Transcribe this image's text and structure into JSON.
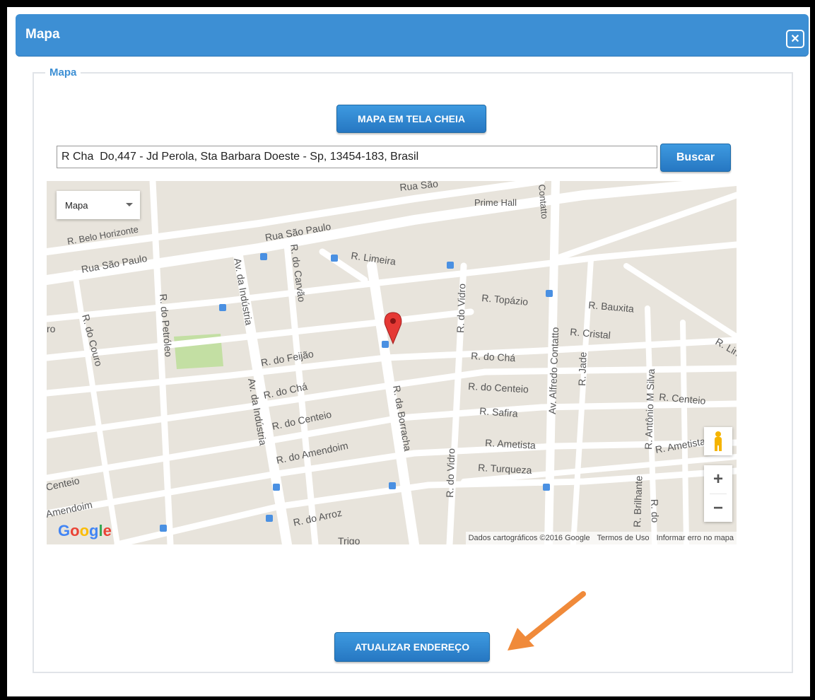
{
  "dialog": {
    "title": "Mapa",
    "close_icon": "close-icon"
  },
  "fieldset": {
    "legend": "Mapa"
  },
  "buttons": {
    "fullscreen": "MAPA EM TELA CHEIA",
    "search": "Buscar",
    "update": "ATUALIZAR ENDEREÇO"
  },
  "search": {
    "value": "R Cha  Do,447 - Jd Perola, Sta Barbara Doeste - Sp, 13454-183, Brasil"
  },
  "map": {
    "type_select": "Mapa",
    "streets": [
      "Rua São Paulo",
      "Rua São Paulo",
      "R. Belo Horizonte",
      "R. Limeira",
      "Prime Hall",
      "Contatto",
      "R. Topázio",
      "R. Bauxita",
      "R. Cristal",
      "R. do Chá",
      "R. do Centeio",
      "R. Centeio",
      "R. Safira",
      "R. Ametista",
      "R. Ametista",
      "R. Turqueza",
      "R. do Feijão",
      "R. do Chá",
      "R. do Centeio",
      "R. do Amendoim",
      "R. do Arroz",
      "R. do Petróleo",
      "R. do Couro",
      "Av. da Indústria",
      "Av. da Indústria",
      "R. do Carvão",
      "R. da Borracha",
      "R. do Vidro",
      "R. do Vidro",
      "Av. Alfredo Contatto",
      "R. Jade",
      "R. Antônio M Silva",
      "R. Brilhante",
      "Rua São",
      "R. Lin",
      "Centeio",
      "Amendoim",
      "ro",
      "Trigo",
      "R. do"
    ],
    "attribution": {
      "data": "Dados cartográficos ©2016 Google",
      "terms": "Termos de Uso",
      "report": "Informar erro no mapa"
    },
    "logo": "Google",
    "zoom_in": "+",
    "zoom_out": "−",
    "marker_color": "#e53935"
  },
  "colors": {
    "accent": "#3d8fd4",
    "arrow": "#f08a3a"
  }
}
